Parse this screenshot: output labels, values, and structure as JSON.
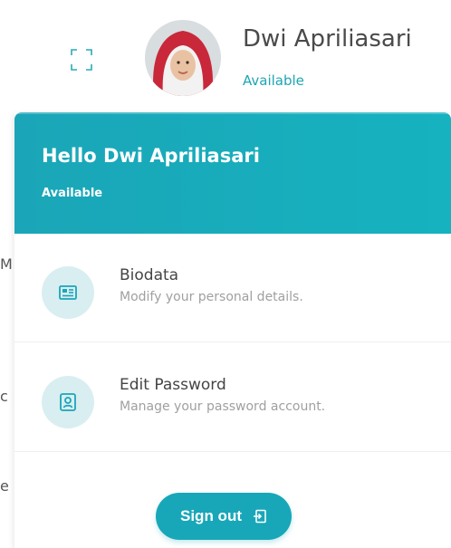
{
  "header": {
    "user_name": "Dwi Apriliasari",
    "user_status": "Available",
    "avatar_icon": "user-avatar-photo",
    "expand_icon": "fullscreen-icon"
  },
  "background_letters": [
    "M",
    "c",
    "e"
  ],
  "dropdown": {
    "greeting": "Hello Dwi Apriliasari",
    "status": "Available",
    "items": [
      {
        "title": "Biodata",
        "description": "Modify your personal details.",
        "icon": "id-card-icon"
      },
      {
        "title": "Edit Password",
        "description": "Manage your password account.",
        "icon": "user-lock-icon"
      }
    ],
    "sign_out_label": "Sign out",
    "sign_out_icon": "logout-icon"
  },
  "colors": {
    "accent": "#1aa6b8",
    "icon_bg": "#d9eef1",
    "status_text": "#1ea5b6"
  }
}
